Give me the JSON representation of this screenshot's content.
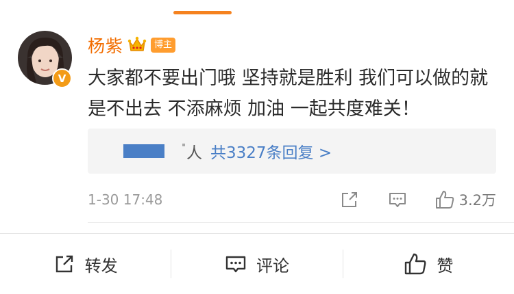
{
  "post": {
    "username": "杨紫",
    "badge": "博主",
    "verified_mark": "V",
    "content": "大家都不要出门哦 坚持就是胜利 我们可以做的就是不出去 不添麻烦 加油 一起共度难关！",
    "replies_suffix": "人",
    "replies_link": "共3327条回复 >",
    "timestamp": "1-30 17:48",
    "like_count": "3.2万"
  },
  "toolbar": {
    "repost_label": "转发",
    "comment_label": "评论",
    "like_label": "赞"
  },
  "colors": {
    "accent": "#f26d00",
    "link": "#4a7fc6",
    "badge": "#ff9d2f",
    "indicator": "#f5821f"
  },
  "icons": [
    "crown-icon",
    "share-icon",
    "comment-icon",
    "like-icon",
    "repost-icon"
  ]
}
